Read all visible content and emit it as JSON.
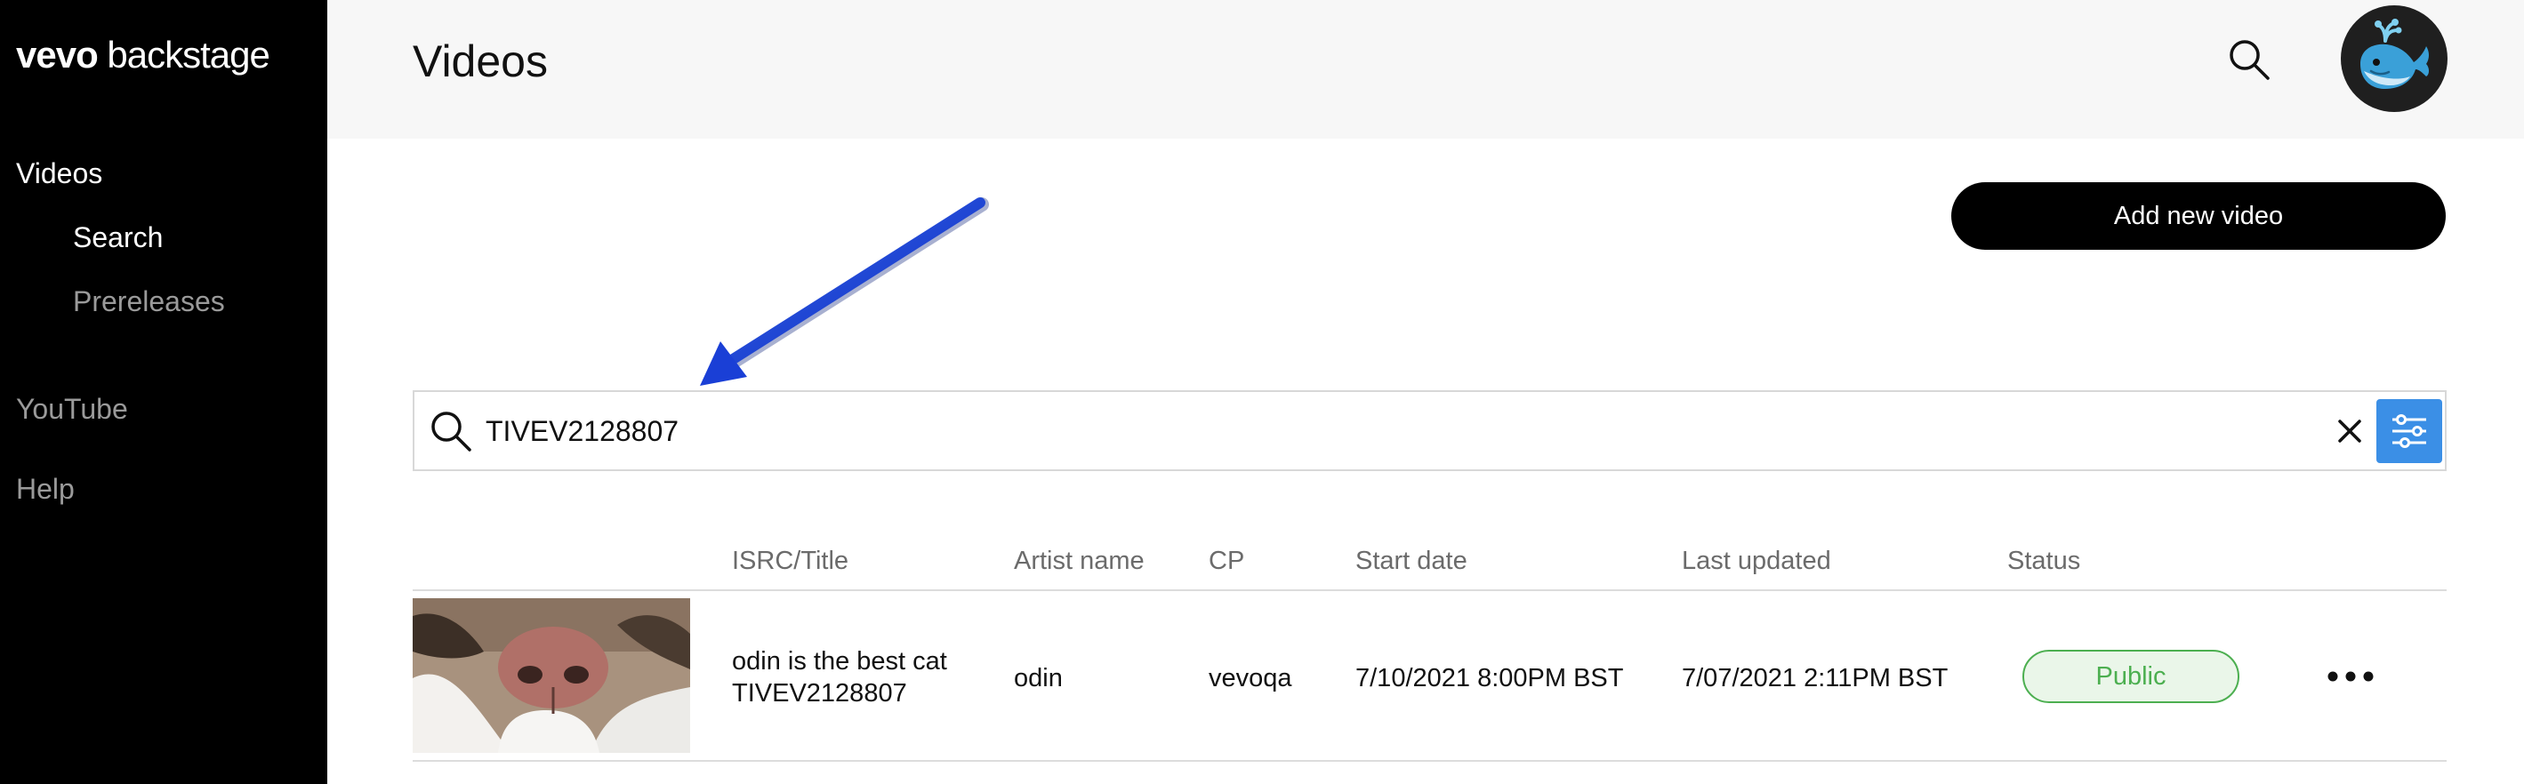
{
  "sidebar": {
    "logo_bold": "vevo",
    "logo_light": "backstage",
    "items": [
      {
        "label": "Videos"
      },
      {
        "label": "Search"
      },
      {
        "label": "Prereleases"
      },
      {
        "label": "YouTube"
      },
      {
        "label": "Help"
      }
    ]
  },
  "header": {
    "title": "Videos",
    "search_icon": "search-icon",
    "avatar_icon": "whale-avatar"
  },
  "actions": {
    "add_label": "Add new video"
  },
  "search": {
    "value": "TIVEV2128807",
    "filter_icon": "sliders-icon",
    "clear_icon": "close-icon"
  },
  "table": {
    "columns": [
      "ISRC/Title",
      "Artist name",
      "CP",
      "Start date",
      "Last updated",
      "Status"
    ],
    "rows": [
      {
        "title": "odin is the best cat",
        "isrc": "TIVEV2128807",
        "artist": "odin",
        "cp": "vevoqa",
        "start_date": "7/10/2021 8:00PM BST",
        "last_updated": "7/07/2021 2:11PM BST",
        "status": "Public"
      }
    ]
  },
  "colors": {
    "sidebar_bg": "#000000",
    "header_bg": "#f7f7f7",
    "filter_button": "#3b8fe6",
    "status_public": "#4caf50",
    "annotation_arrow": "#1a3fd6"
  }
}
